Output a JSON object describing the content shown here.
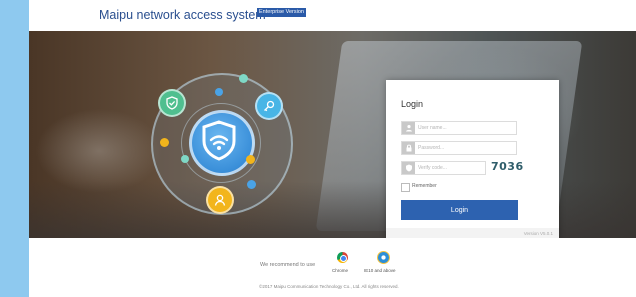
{
  "header": {
    "brand_title": "Maipu network access system",
    "edition_badge": "Enterprise Version"
  },
  "login": {
    "title": "Login",
    "username_placeholder": "User name...",
    "password_placeholder": "Password...",
    "verify_placeholder": "Verify code...",
    "captcha_code": "7036",
    "remember_label": "Remember",
    "login_button": "Login",
    "version": "Version V5.0.1"
  },
  "footer": {
    "recommend_text": "We recommend to use",
    "browsers": [
      {
        "name": "Chrome",
        "icon": "chrome-icon"
      },
      {
        "name": "IE10 and above",
        "icon": "ie-icon"
      }
    ],
    "copyright": "©2017 Maipu Communication Technology Co., Ltd. All rights reserved."
  },
  "colors": {
    "brand_blue": "#2a4f8f",
    "button_blue": "#2d62b0",
    "side_bar": "#8ec9ef",
    "captcha": "#2f5d6a"
  },
  "illustration": {
    "center_icon": "wifi-shield-icon",
    "orbit_icons": [
      "shield-check-icon",
      "key-icon",
      "user-icon"
    ]
  }
}
